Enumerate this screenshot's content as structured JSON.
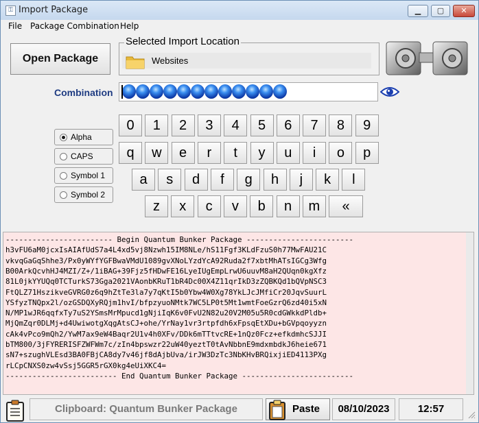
{
  "window": {
    "title": "Import Package",
    "app_icon": "ap-icon",
    "buttons": {
      "minimize": "minimize-icon",
      "maximize": "maximize-icon",
      "close": "close-icon"
    }
  },
  "menu": {
    "items": [
      "File",
      "Package Combination",
      "Help"
    ]
  },
  "open_package": {
    "label": "Open Package"
  },
  "location": {
    "title": "Selected Import Location",
    "value": "Websites",
    "icon": "folder-icon"
  },
  "vault": {
    "icon": "vault-icon"
  },
  "combination": {
    "label": "Combination",
    "masked_count": 12,
    "reveal_icon": "eye-icon",
    "accent": "#1f3c82"
  },
  "keypad": {
    "row1": [
      "0",
      "1",
      "2",
      "3",
      "4",
      "5",
      "6",
      "7",
      "8",
      "9"
    ],
    "row2": [
      "q",
      "w",
      "e",
      "r",
      "t",
      "y",
      "u",
      "i",
      "o",
      "p"
    ],
    "row3": [
      "a",
      "s",
      "d",
      "f",
      "g",
      "h",
      "j",
      "k",
      "l"
    ],
    "row4": [
      "z",
      "x",
      "c",
      "v",
      "b",
      "n",
      "m",
      "«"
    ]
  },
  "modes": [
    {
      "label": "Alpha",
      "selected": true
    },
    {
      "label": "CAPS",
      "selected": false
    },
    {
      "label": "Symbol 1",
      "selected": false
    },
    {
      "label": "Symbol 2",
      "selected": false
    }
  ],
  "package": {
    "background": "#fde6e6",
    "lines": [
      "------------------------ Begin Quantum Bunker Package ------------------------",
      "h3vFU6aM0jcxIsAIAfUdS7a4L4xd5vj8Nzwh15IM8NLe/hS11Fgf3KLdFzuS0h77MwFAU21C",
      "vkvqGaGqShhe3/Px0yWYfYGFBwaVMdU1089gvXNoLYzdYcA92Ruda2f7xbtMhATsIGCg3Wfg",
      "B00ArkQcvhHJ4MZI/Z+/1iBAG+39Fjz5fHDwFE16LyeIUgEmpLrwU6uuvM8aH2QUqn0kgXfz",
      "81L0jkYYUQq0TCTurkS73Gga2021VAonbKRuT1bR4Dc00X4Z11qrIkD3zZQBKQd1bQVpNSC3",
      "FtQLZ71HszikveGVRG0z6q9hZtTe3la7y7qKtI5b0Ybw4W0Xg78YkLJcJMfiCr20JqvSuurL",
      "YSfyzTNQpx2l/ozGSDQXyRQjm1hvI/bfpzyuoNMtk7WC5LP0t5Mt1wmtFoeGzrQ6zd40i5xN",
      "N/MP1wJR6qqfxTy7uS2YSmsMrMpucd1gNjiIqK6v0FvU2N82u20V2M05u5R0cdGWkkdPldb+",
      "MjQmZqr0DLMj+d4UwiwotgXqgAtsCJ+ohe/YrNay1vr3rtpfdh6xFpsqEtXDu+bGVpqoyyzn",
      "cAk4vPco9mQh2/YwM7ax9eW4Baqr2U1v4h0XFv/DDk6mTTtvcRE+1nQz0Fcz+efkdmhcSJJI",
      "bTM800/3jFYRERISFZWFWm7c/zIn4bpswzr22uW40yeztT0tAvNbbnE9mdxmbdkJ6heie671",
      "sN7+szughVLEsd3BA0FBjCA8dy7v46jf8dAjbUva/irJW3DzTc3NbKHvBRQixjiED4113PXg",
      "rLCpCNXS0zw4vSsj5GGR5rGX0kg4eUiXKC4=",
      "------------------------- End Quantum Bunker Package -------------------------"
    ]
  },
  "status": {
    "clipboard_icon": "clipboard-icon",
    "clipboard_text": "Clipboard: Quantum Bunker Package",
    "paste_label": "Paste",
    "date": "08/10/2023",
    "time": "12:57"
  }
}
